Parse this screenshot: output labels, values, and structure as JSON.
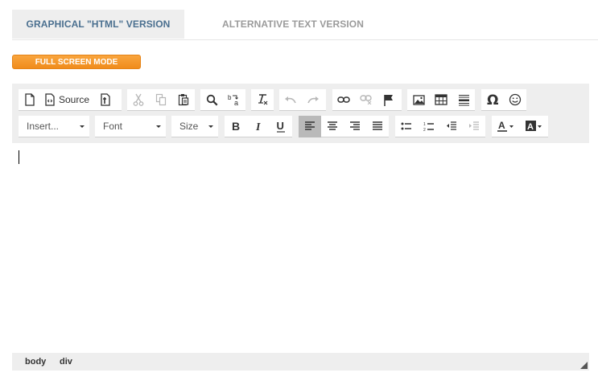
{
  "tabs": {
    "graphical": "GRAPHICAL \"HTML\" VERSION",
    "alternative": "ALTERNATIVE TEXT VERSION"
  },
  "fullscreen_label": "FULL SCREEN MODE",
  "toolbar": {
    "source_label": "Source",
    "insert_placeholder": "Insert...",
    "font_placeholder": "Font",
    "size_placeholder": "Size"
  },
  "statusbar": {
    "path": [
      "body",
      "div"
    ]
  },
  "colors": {
    "accent_orange": "#f4961f",
    "active_tab_text": "#4a6f8f",
    "toolbar_bg": "#eeeeee"
  }
}
